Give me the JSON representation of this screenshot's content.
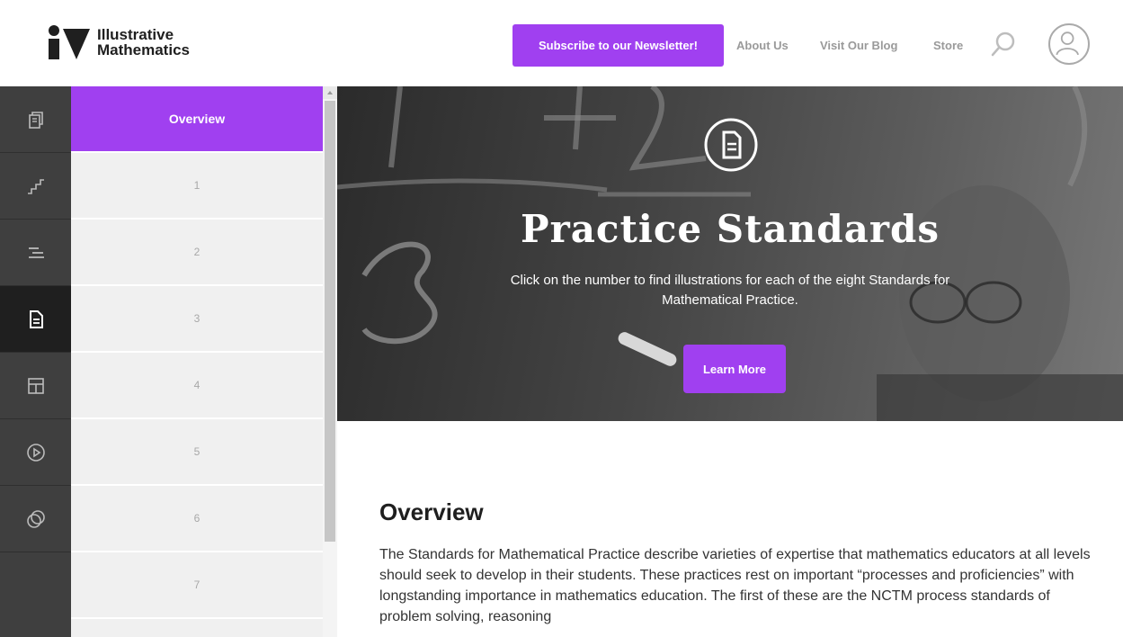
{
  "header": {
    "logo_line1": "Illustrative",
    "logo_line2": "Mathematics",
    "subscribe_label": "Subscribe to our Newsletter!",
    "nav": [
      "About Us",
      "Visit Our Blog",
      "Store"
    ]
  },
  "rail": {
    "icons": [
      "documents-icon",
      "stairs-icon",
      "progression-icon",
      "document-icon",
      "layout-icon",
      "play-icon",
      "overlap-icon"
    ],
    "active_index": 3
  },
  "sections": {
    "items": [
      "Overview",
      "1",
      "2",
      "3",
      "4",
      "5",
      "6",
      "7"
    ],
    "active_index": 0
  },
  "hero": {
    "title": "Practice Standards",
    "subtitle": "Click on the number to find illustrations for each of the eight Standards for Mathematical Practice.",
    "button_label": "Learn More"
  },
  "content": {
    "heading": "Overview",
    "paragraph": "The Standards for Mathematical Practice describe varieties of expertise that mathematics educators at all levels should seek to develop in their students. These practices rest on important “processes and proficiencies” with longstanding importance in mathematics education. The first of these are the NCTM process standards of problem solving, reasoning"
  },
  "colors": {
    "accent": "#a040f0",
    "rail_bg": "#3f3f3f",
    "rail_active": "#1f1f1f",
    "list_bg": "#f0f0f0"
  }
}
